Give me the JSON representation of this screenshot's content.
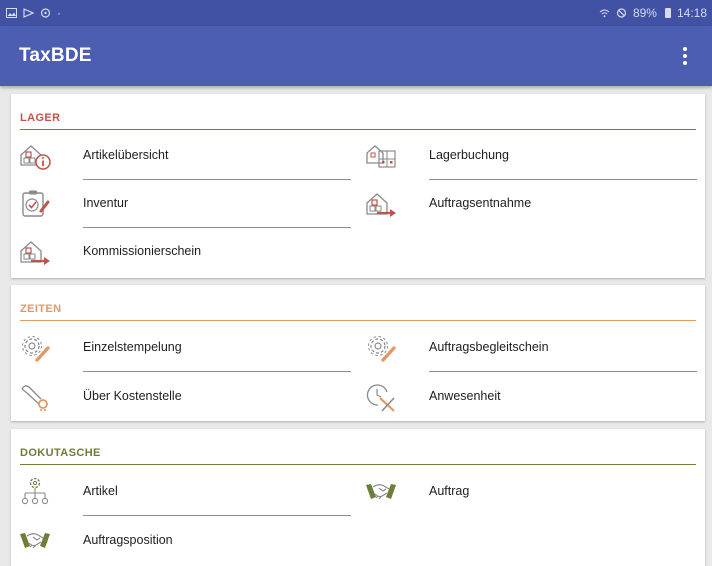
{
  "status_bar": {
    "battery": "89%",
    "time": "14:18"
  },
  "app_bar": {
    "title": "TaxBDE",
    "menu_icon": "more-vert-icon"
  },
  "colors": {
    "primary": "#4b5eb2",
    "status_bar": "#4151a3",
    "lager": "#c0544a",
    "zeiten": "#e19a66",
    "dokutasche": "#6d7d3a"
  },
  "sections": {
    "lager": {
      "title": "LAGER",
      "items": [
        {
          "label": "Artikelübersicht",
          "icon": "warehouse-info-icon"
        },
        {
          "label": "Lagerbuchung",
          "icon": "warehouse-shelves-icon"
        },
        {
          "label": "Inventur",
          "icon": "clipboard-check-icon"
        },
        {
          "label": "Auftragsentnahme",
          "icon": "warehouse-export-icon"
        },
        {
          "label": "Kommissionierschein",
          "icon": "warehouse-export-icon"
        }
      ]
    },
    "zeiten": {
      "title": "ZEITEN",
      "items": [
        {
          "label": "Einzelstempelung",
          "icon": "gear-pencil-icon"
        },
        {
          "label": "Auftragsbegleitschein",
          "icon": "gear-pencil-icon"
        },
        {
          "label": "Über Kostenstelle",
          "icon": "tools-icon"
        },
        {
          "label": "Anwesenheit",
          "icon": "clock-tools-icon"
        }
      ]
    },
    "dokutasche": {
      "title": "DOKUTASCHE",
      "items": [
        {
          "label": "Artikel",
          "icon": "hierarchy-gear-icon"
        },
        {
          "label": "Auftrag",
          "icon": "handshake-icon"
        },
        {
          "label": "Auftragsposition",
          "icon": "handshake-icon"
        }
      ]
    }
  }
}
